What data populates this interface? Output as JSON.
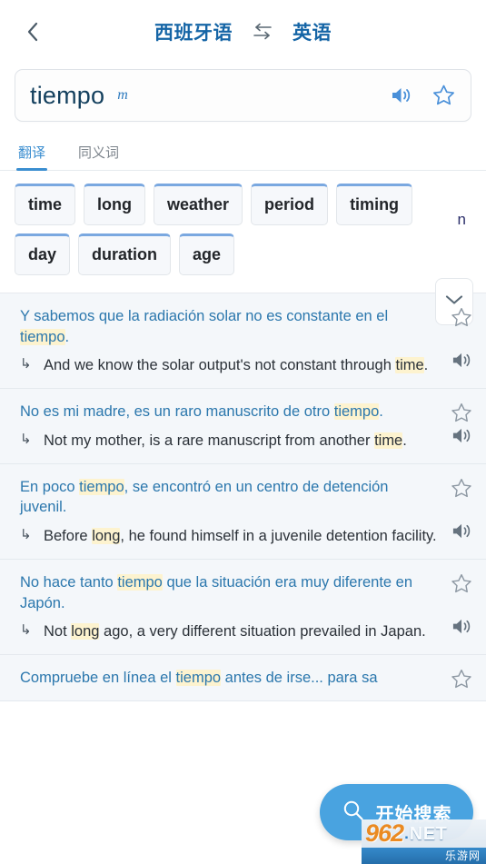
{
  "header": {
    "back_icon": "chevron-left-icon",
    "source_language": "西班牙语",
    "swap_icon": "swap-horizontal-icon",
    "target_language": "英语"
  },
  "search": {
    "value": "tiempo",
    "gender": "m",
    "speaker_icon": "speaker-icon",
    "favorite_icon": "star-outline-icon"
  },
  "tabs": [
    {
      "label": "翻译",
      "active": true
    },
    {
      "label": "同义词",
      "active": false
    }
  ],
  "translations": {
    "pos_label": "n",
    "expand_icon": "chevron-down-icon",
    "rows": [
      [
        "time",
        "long",
        "weather",
        "period",
        "timing"
      ],
      [
        "day",
        "duration",
        "age"
      ]
    ]
  },
  "examples": [
    {
      "source_pre": "Y sabemos que la radiación solar no es constante en el ",
      "source_hl": "tiempo",
      "source_post": ".",
      "target_pre": "And we know the solar output's not constant through ",
      "target_hl": "time",
      "target_post": ".",
      "arrow": "↳",
      "star_icon": "star-outline-icon",
      "speaker_icon": "speaker-icon"
    },
    {
      "source_pre": "No es mi madre, es un raro manuscrito de otro ",
      "source_hl": "tiempo",
      "source_post": ".",
      "target_pre": "Not my mother, is a rare manuscript from another ",
      "target_hl": "time",
      "target_post": ".",
      "arrow": "↳",
      "star_icon": "star-outline-icon",
      "speaker_icon": "speaker-icon"
    },
    {
      "source_pre": "En poco ",
      "source_hl": "tiempo",
      "source_post": ", se encontró en un centro de detención juvenil.",
      "target_pre": "Before ",
      "target_hl": "long",
      "target_post": ", he found himself in a juvenile detention facility.",
      "arrow": "↳",
      "star_icon": "star-outline-icon",
      "speaker_icon": "speaker-icon"
    },
    {
      "source_pre": "No hace tanto ",
      "source_hl": "tiempo",
      "source_post": " que la situación era muy diferente en Japón.",
      "target_pre": "Not ",
      "target_hl": "long",
      "target_post": " ago, a very different situation prevailed in Japan.",
      "arrow": "↳",
      "star_icon": "star-outline-icon",
      "speaker_icon": "speaker-icon"
    },
    {
      "source_pre": "Compruebe en línea el ",
      "source_hl": "tiempo",
      "source_post": " antes de irse... para sa",
      "target_pre": "",
      "target_hl": "",
      "target_post": "",
      "arrow": "↳",
      "star_icon": "star-outline-icon",
      "speaker_icon": "speaker-icon"
    }
  ],
  "fab": {
    "label": "开始搜索",
    "icon": "search-icon"
  },
  "watermark": {
    "number": "962",
    "dot": ".",
    "net": "NET",
    "cn": "乐游网"
  },
  "colors": {
    "accent_blue": "#3b8ed0",
    "header_blue": "#1565a6",
    "source_text": "#2b77ad",
    "highlight": "#fdf3cf",
    "fab_blue": "#49a3e0",
    "watermark_orange": "#f08a1c",
    "chip_top_border": "#7aa8e0"
  }
}
